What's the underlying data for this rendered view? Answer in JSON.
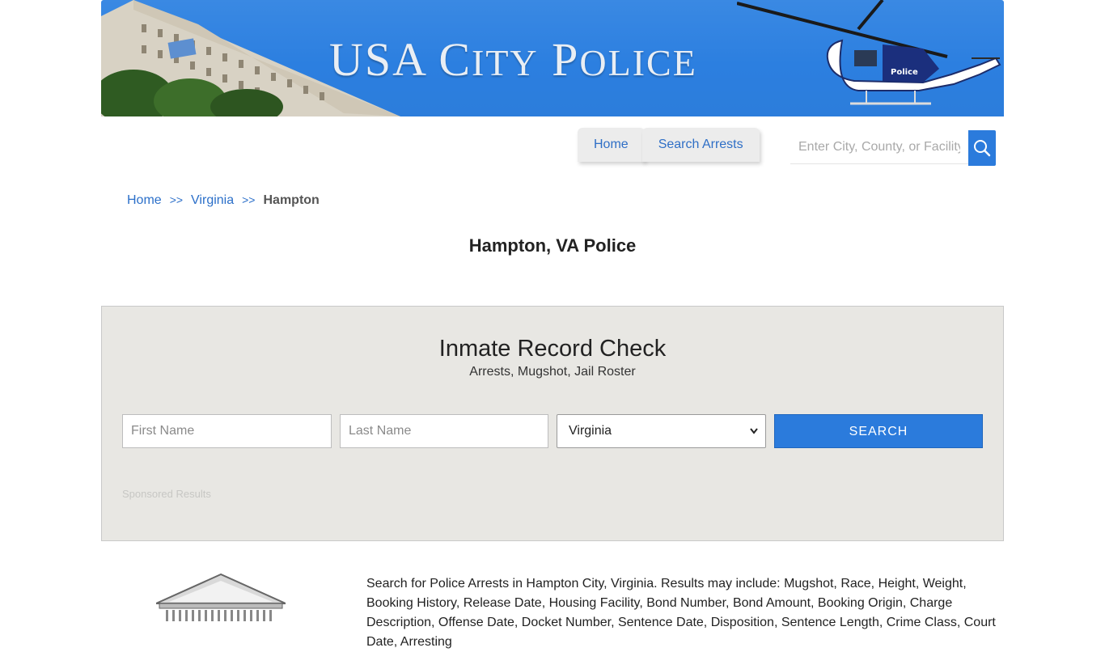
{
  "banner": {
    "title_main": "USA C",
    "title_sc1": "ITY",
    "title_p": " P",
    "title_sc2": "OLICE",
    "helicopter_label": "Police"
  },
  "nav": {
    "tabs": [
      {
        "label": "Home"
      },
      {
        "label": "Search Arrests"
      }
    ]
  },
  "top_search": {
    "placeholder": "Enter City, County, or Facility",
    "icon": "search-icon"
  },
  "breadcrumb": {
    "items": [
      {
        "label": "Home"
      },
      {
        "label": "Virginia"
      }
    ],
    "separator": ">>",
    "current": "Hampton"
  },
  "page_title": "Hampton, VA Police",
  "record_check": {
    "title": "Inmate Record Check",
    "subtitle": "Arrests, Mugshot, Jail Roster",
    "first_name_placeholder": "First Name",
    "last_name_placeholder": "Last Name",
    "state_selected": "Virginia",
    "search_label": "SEARCH",
    "sponsored": "Sponsored Results"
  },
  "description": "Search for Police Arrests in Hampton City, Virginia. Results may include: Mugshot, Race, Height, Weight, Booking History, Release Date, Housing Facility, Bond Number, Bond Amount, Booking Origin, Charge Description, Offense Date, Docket Number, Sentence Date, Disposition, Sentence Length, Crime Class, Court Date, Arresting",
  "colors": {
    "accent": "#2b7bdc",
    "banner_blue": "#2c7fe0",
    "panel_bg": "#e8e7e3",
    "link": "#2b6fc9"
  }
}
